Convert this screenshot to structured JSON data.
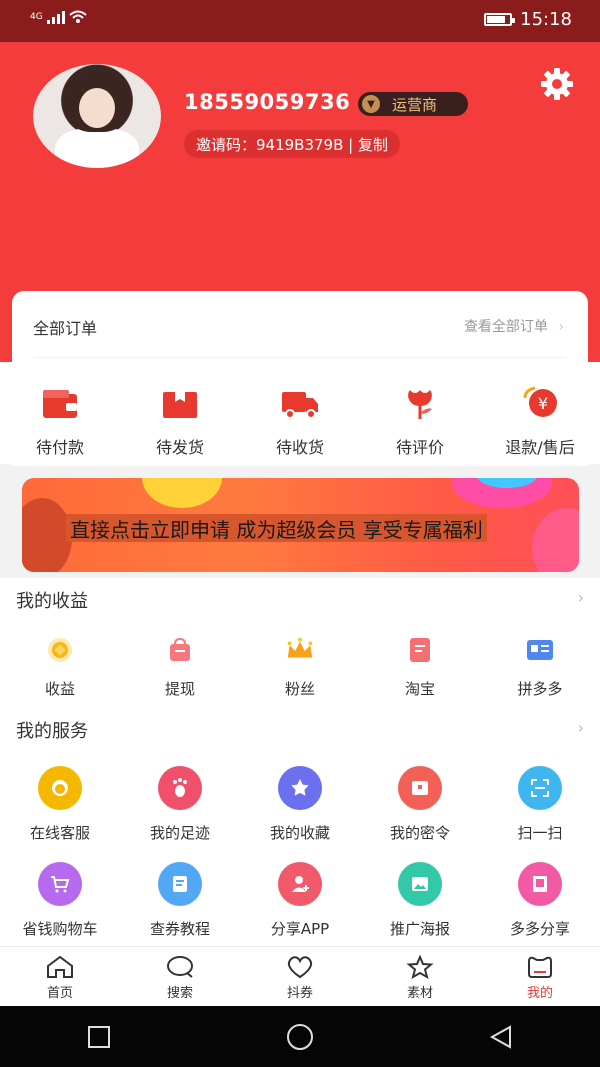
{
  "status_bar": {
    "network": "4G",
    "time": "15:18"
  },
  "profile": {
    "phone": "18559059736",
    "badge": "运营商",
    "invite_label": "邀请码：9419B379B | 复制"
  },
  "orders": {
    "title": "全部订单",
    "view_all": "查看全部订单",
    "items": [
      {
        "label": "待付款",
        "icon": "wallet-icon"
      },
      {
        "label": "待发货",
        "icon": "box-icon"
      },
      {
        "label": "待收货",
        "icon": "truck-icon"
      },
      {
        "label": "待评价",
        "icon": "flower-icon"
      },
      {
        "label": "退款/售后",
        "icon": "refund-icon"
      }
    ]
  },
  "banner": {
    "text": "直接点击立即申请 成为超级会员 享受专属福利"
  },
  "earnings": {
    "title": "我的收益",
    "items": [
      {
        "label": "收益",
        "icon": "coin-icon"
      },
      {
        "label": "提现",
        "icon": "bag-icon"
      },
      {
        "label": "粉丝",
        "icon": "crown-icon"
      },
      {
        "label": "淘宝",
        "icon": "taobao-icon"
      },
      {
        "label": "拼多多",
        "icon": "card-icon"
      }
    ]
  },
  "services": {
    "title": "我的服务",
    "row1": [
      {
        "label": "在线客服",
        "icon": "support-icon",
        "color": "#f5b800"
      },
      {
        "label": "我的足迹",
        "icon": "footprint-icon",
        "color": "#f0506a"
      },
      {
        "label": "我的收藏",
        "icon": "star-icon",
        "color": "#6b70ee"
      },
      {
        "label": "我的密令",
        "icon": "box-icon",
        "color": "#f26057"
      },
      {
        "label": "扫一扫",
        "icon": "scan-icon",
        "color": "#3fb6f0"
      }
    ],
    "row2": [
      {
        "label": "省钱购物车",
        "icon": "cart-icon",
        "color": "#b56af0"
      },
      {
        "label": "查券教程",
        "icon": "book-icon",
        "color": "#52a8f4"
      },
      {
        "label": "分享APP",
        "icon": "add-user-icon",
        "color": "#f05a6a"
      },
      {
        "label": "推广海报",
        "icon": "image-icon",
        "color": "#33c9a8"
      },
      {
        "label": "多多分享",
        "icon": "doc-icon",
        "color": "#f25aa6"
      }
    ]
  },
  "bottom_nav": [
    {
      "label": "首页",
      "icon": "home-icon"
    },
    {
      "label": "搜索",
      "icon": "search-icon"
    },
    {
      "label": "抖券",
      "icon": "heart-icon"
    },
    {
      "label": "素材",
      "icon": "star-outline-icon"
    },
    {
      "label": "我的",
      "icon": "profile-icon",
      "active": true
    }
  ],
  "colors": {
    "header": "#f53c3c",
    "statusbar": "#8a1c1c",
    "accent": "#e23b3b"
  }
}
